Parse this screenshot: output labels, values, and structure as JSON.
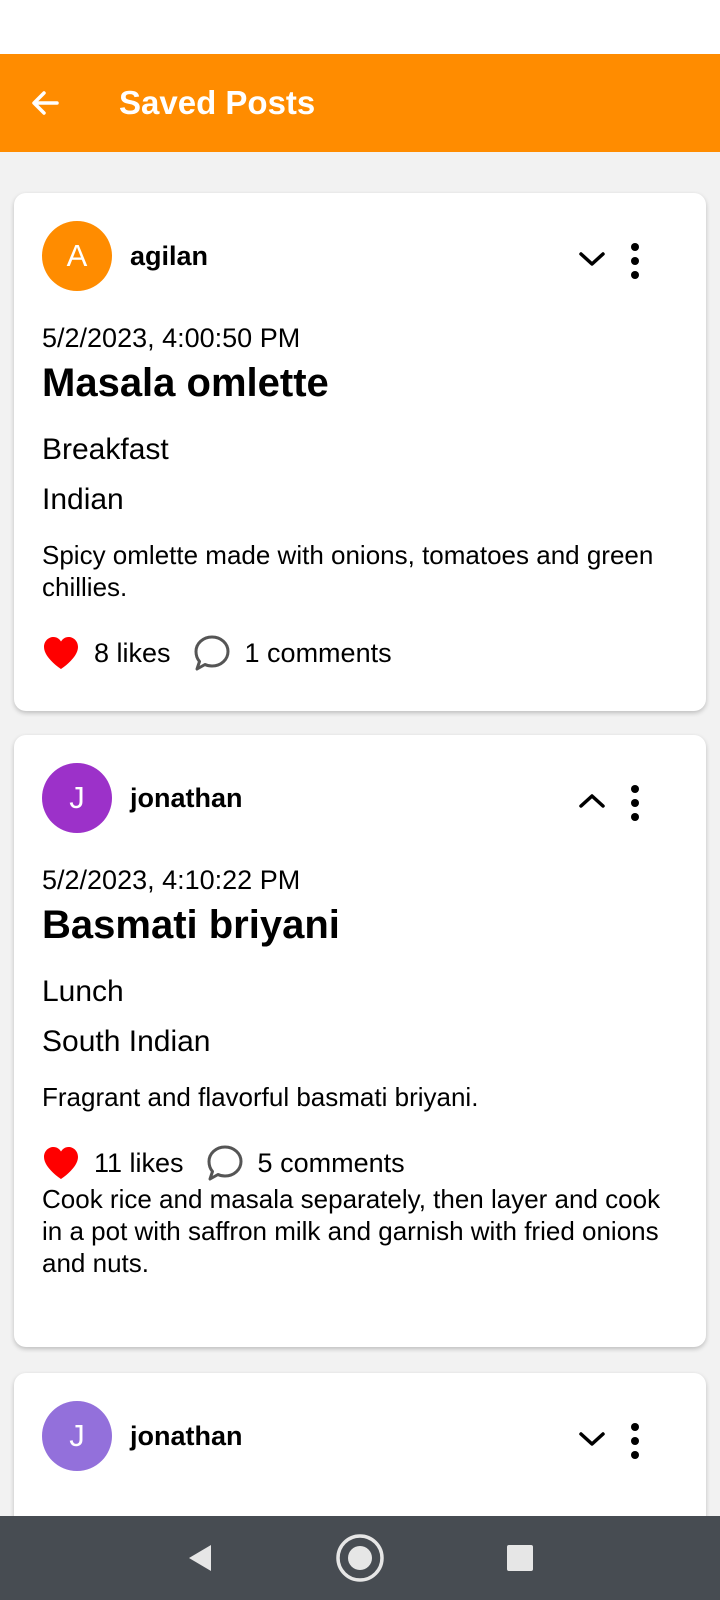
{
  "app": {
    "title": "Saved Posts",
    "accent": "#ff8c00"
  },
  "posts": [
    {
      "avatar_letter": "A",
      "avatar_color": "#ff8c00",
      "username": "agilan",
      "expanded": false,
      "timestamp": "5/2/2023, 4:00:50 PM",
      "title": "Masala omlette",
      "meal": "Breakfast",
      "cuisine": "Indian",
      "description": "Spicy omlette made with onions, tomatoes and green chillies.",
      "likes": "8 likes",
      "comments": "1 comments"
    },
    {
      "avatar_letter": "J",
      "avatar_color": "#9c31c9",
      "username": "jonathan",
      "expanded": true,
      "timestamp": "5/2/2023, 4:10:22 PM",
      "title": "Basmati briyani",
      "meal": "Lunch",
      "cuisine": "South Indian",
      "description": "Fragrant and flavorful basmati briyani.",
      "likes": "11 likes",
      "comments": "5 comments",
      "recipe": "Cook rice and masala separately, then layer and cook in a pot with saffron milk and garnish with fried onions and nuts."
    },
    {
      "avatar_letter": "J",
      "avatar_color": "#9370db",
      "username": "jonathan",
      "expanded": false
    }
  ],
  "icons": {
    "back": "arrow-left-icon",
    "expand": "chevron-down-icon",
    "collapse": "chevron-up-icon",
    "more": "more-vertical-icon",
    "like": "heart-icon",
    "comment": "comment-icon",
    "nav_back": "triangle-back-icon",
    "nav_home": "circle-home-icon",
    "nav_recent": "square-recents-icon"
  },
  "colors": {
    "heart": "#ff0000",
    "navbar": "#474c52",
    "appbar": "#ff8c00"
  }
}
